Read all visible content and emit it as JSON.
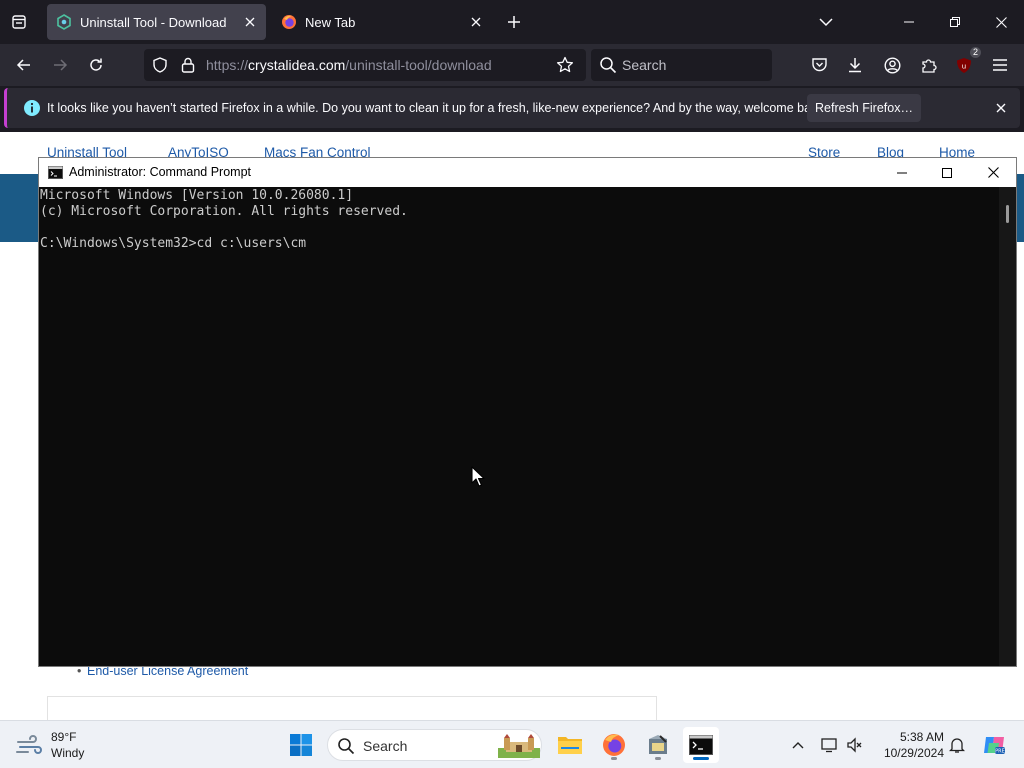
{
  "browser": {
    "tabs": [
      {
        "title": "Uninstall Tool - Download",
        "active": true
      },
      {
        "title": "New Tab",
        "active": false
      }
    ],
    "url": {
      "scheme": "https://",
      "host": "crystalidea.com",
      "path": "/uninstall-tool/download"
    },
    "search_placeholder": "Search",
    "extensions_badge": "2",
    "notification": {
      "message": "It looks like you haven’t started Firefox in a while. Do you want to clean it up for a fresh, like-new experience? And by the way, welcome back!",
      "button": "Refresh Firefox…"
    }
  },
  "webpage": {
    "nav": [
      "Uninstall Tool",
      "AnyToISO",
      "Macs Fan Control",
      "Store",
      "Blog",
      "Home"
    ],
    "eula_link": "End-user License Agreement"
  },
  "cmd": {
    "title": "Administrator: Command Prompt",
    "lines": [
      "Microsoft Windows [Version 10.0.26080.1]",
      "(c) Microsoft Corporation. All rights reserved.",
      "",
      "C:\\Windows\\System32>cd c:\\users\\cm"
    ]
  },
  "taskbar": {
    "weather": {
      "temp": "89°F",
      "condition": "Windy"
    },
    "search_placeholder": "Search",
    "time": "5:38 AM",
    "date": "10/29/2024"
  },
  "colors": {
    "firefox_dark": "#1c1b22",
    "toolbar": "#2b2a33",
    "notification_accent": "#c43fd0",
    "link_blue": "#1e5aa8",
    "windows_accent": "#0067c0"
  }
}
